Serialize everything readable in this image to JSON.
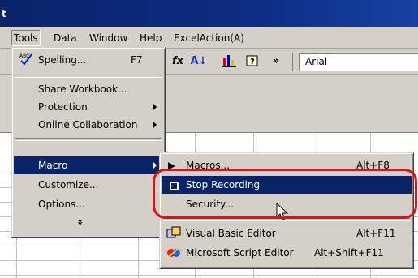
{
  "titlebar": {
    "text": "t"
  },
  "menubar": {
    "items": [
      "Tools",
      "Data",
      "Window",
      "Help",
      "ExcelAction(A)"
    ]
  },
  "toolbar": {
    "fx_label": "fx",
    "sort_label": "A↓",
    "more_label": "»",
    "font_value": "Arial"
  },
  "tools_menu": {
    "items": [
      {
        "label": "Spelling...",
        "shortcut": "F7"
      },
      {
        "label": "Share Workbook..."
      },
      {
        "label": "Protection"
      },
      {
        "label": "Online Collaboration"
      },
      {
        "label": "Macro"
      },
      {
        "label": "Customize..."
      },
      {
        "label": "Options..."
      },
      {
        "label": "»"
      }
    ]
  },
  "macro_menu": {
    "items": [
      {
        "label": "Macros...",
        "shortcut": "Alt+F8"
      },
      {
        "label": "Stop Recording"
      },
      {
        "label": "Security..."
      },
      {
        "label": "Visual Basic Editor",
        "shortcut": "Alt+F11"
      },
      {
        "label": "Microsoft Script Editor",
        "shortcut": "Alt+Shift+F11"
      }
    ]
  },
  "colors": {
    "highlight": "#0a246a",
    "callout": "#e0101a",
    "face": "#d4d0c8"
  }
}
